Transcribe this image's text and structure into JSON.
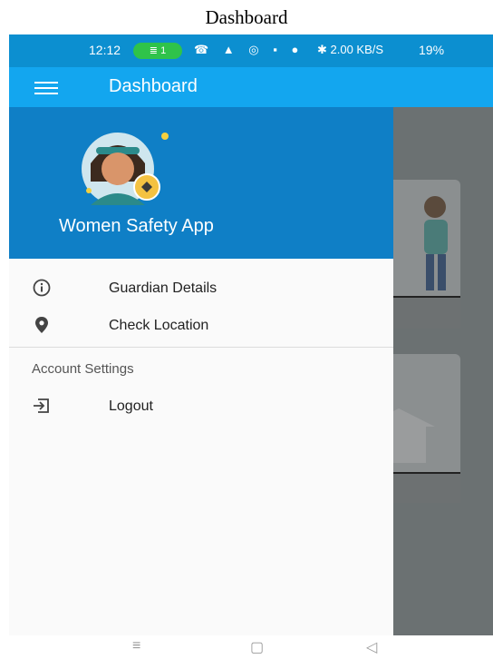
{
  "caption": "Dashboard",
  "status_bar": {
    "time": "12:12",
    "wifi_badge": "≣ 1",
    "icons": "☎ ▲ ◎ ▪ ●",
    "network": "✱ 2.00 KB/S",
    "battery": "19%"
  },
  "app_bar": {
    "title": "Dashboard"
  },
  "drawer": {
    "header_title": "Women Safety App",
    "items": [
      {
        "label": "Guardian Details",
        "icon": "info-icon"
      },
      {
        "label": "Check Location",
        "icon": "location-pin-icon"
      }
    ],
    "section_title": "Account Settings",
    "section_items": [
      {
        "label": "Logout",
        "icon": "logout-icon"
      }
    ]
  },
  "colors": {
    "status_bar": "#0c8fd0",
    "app_bar": "#13a6ef",
    "drawer_header": "#0f7fc6",
    "scrim": "#6b7172"
  },
  "system_nav": {
    "menu": "≡",
    "home": "▢",
    "back": "◁"
  }
}
